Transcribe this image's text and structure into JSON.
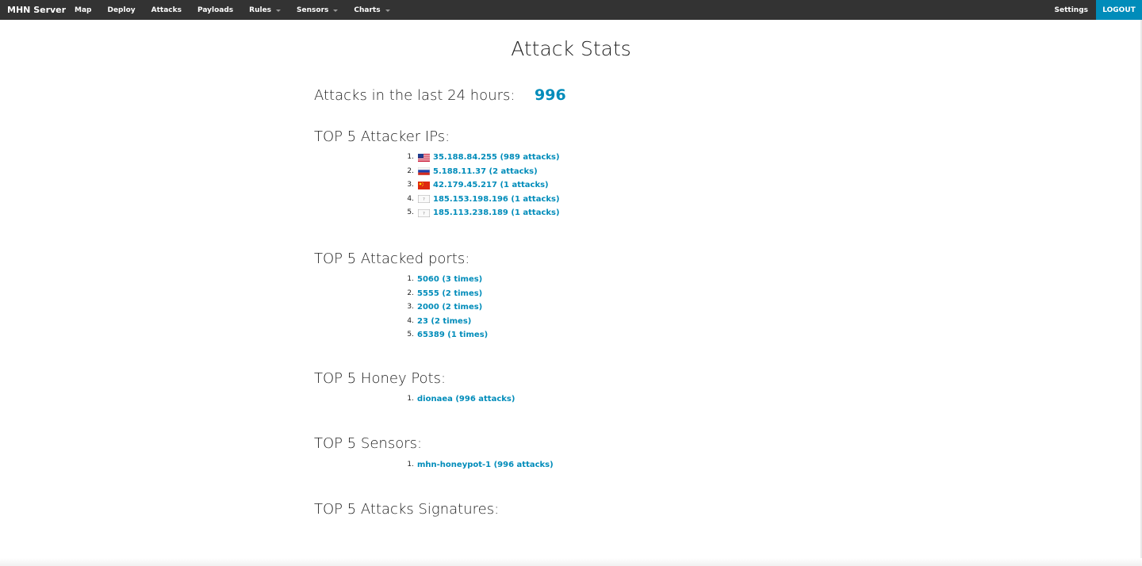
{
  "navbar": {
    "brand": "MHN Server",
    "items": [
      {
        "label": "Map",
        "dropdown": false
      },
      {
        "label": "Deploy",
        "dropdown": false
      },
      {
        "label": "Attacks",
        "dropdown": false
      },
      {
        "label": "Payloads",
        "dropdown": false
      },
      {
        "label": "Rules",
        "dropdown": true
      },
      {
        "label": "Sensors",
        "dropdown": true
      },
      {
        "label": "Charts",
        "dropdown": true
      }
    ],
    "settings": "Settings",
    "logout": "LOGOUT"
  },
  "page": {
    "title": "Attack Stats",
    "attacks_24h_label": "Attacks in the last 24 hours:",
    "attacks_24h_count": "996"
  },
  "sections": {
    "ips": {
      "heading": "TOP 5 Attacker IPs:",
      "items": [
        {
          "num": "1.",
          "flag": "us-flag-icon",
          "text": "35.188.84.255 (989 attacks)"
        },
        {
          "num": "2.",
          "flag": "ru-flag-icon",
          "text": "5.188.11.37 (2 attacks)"
        },
        {
          "num": "3.",
          "flag": "cn-flag-icon",
          "text": "42.179.45.217 (1 attacks)"
        },
        {
          "num": "4.",
          "flag": "unknown-flag-icon",
          "text": "185.153.198.196 (1 attacks)"
        },
        {
          "num": "5.",
          "flag": "unknown-flag-icon",
          "text": "185.113.238.189 (1 attacks)"
        }
      ]
    },
    "ports": {
      "heading": "TOP 5 Attacked ports:",
      "items": [
        {
          "num": "1.",
          "text": "5060 (3 times)"
        },
        {
          "num": "2.",
          "text": "5555 (2 times)"
        },
        {
          "num": "3.",
          "text": "2000 (2 times)"
        },
        {
          "num": "4.",
          "text": "23 (2 times)"
        },
        {
          "num": "5.",
          "text": "65389 (1 times)"
        }
      ]
    },
    "honeypots": {
      "heading": "TOP 5 Honey Pots:",
      "items": [
        {
          "num": "1.",
          "text": "dionaea (996 attacks)"
        }
      ]
    },
    "sensors": {
      "heading": "TOP 5 Sensors:",
      "items": [
        {
          "num": "1.",
          "text": "mhn-honeypot-1 (996 attacks)"
        }
      ]
    },
    "signatures": {
      "heading": "TOP 5 Attacks Signatures:"
    }
  },
  "colors": {
    "navbar_bg": "#333333",
    "accent": "#008cba",
    "text": "#222222"
  }
}
